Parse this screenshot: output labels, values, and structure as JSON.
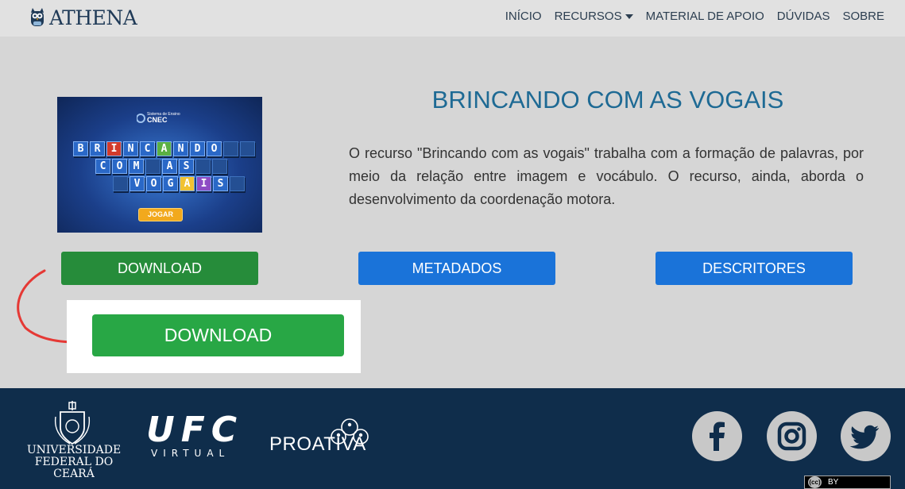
{
  "navbar": {
    "brand": "ATHENA",
    "items": [
      {
        "label": "INÍCIO"
      },
      {
        "label": "RECURSOS",
        "has_dropdown": true
      },
      {
        "label": "MATERIAL DE APOIO"
      },
      {
        "label": "DÚVIDAS"
      },
      {
        "label": "SOBRE"
      }
    ]
  },
  "resource": {
    "title": "BRINCANDO COM AS VOGAIS",
    "description": "O recurso \"Brincando com as vogais\" trabalha com a formação de palavras, por meio da relação entre imagem e vocábulo. O recurso, ainda, aborda o desenvolvimento da coordenação motora.",
    "thumbnail": {
      "brand_top": "Sistema de Ensino",
      "brand_name": "CNEC",
      "word1": "BRINCANDO",
      "word2": "COM AS",
      "word3": "VOGAIS",
      "play_label": "JOGAR"
    }
  },
  "actions": {
    "download_label": "DOWNLOAD",
    "metadata_label": "METADADOS",
    "descriptors_label": "DESCRITORES"
  },
  "callout": {
    "download_label": "DOWNLOAD"
  },
  "footer": {
    "univ_line1": "UNIVERSIDADE",
    "univ_line2": "FEDERAL DO CEARÁ",
    "ufc_big": "UFC",
    "ufc_small": "VIRTUAL",
    "proativa": "PROATIVA",
    "license": "BY",
    "license_cc": "(cc)",
    "social": [
      "facebook-icon",
      "instagram-icon",
      "twitter-icon"
    ]
  },
  "colors": {
    "download_green": "#268c3a",
    "callout_green": "#28a745",
    "blue_button": "#1a73d9",
    "title_blue": "#1e6a94",
    "footer_navy": "#0f2d4b"
  }
}
